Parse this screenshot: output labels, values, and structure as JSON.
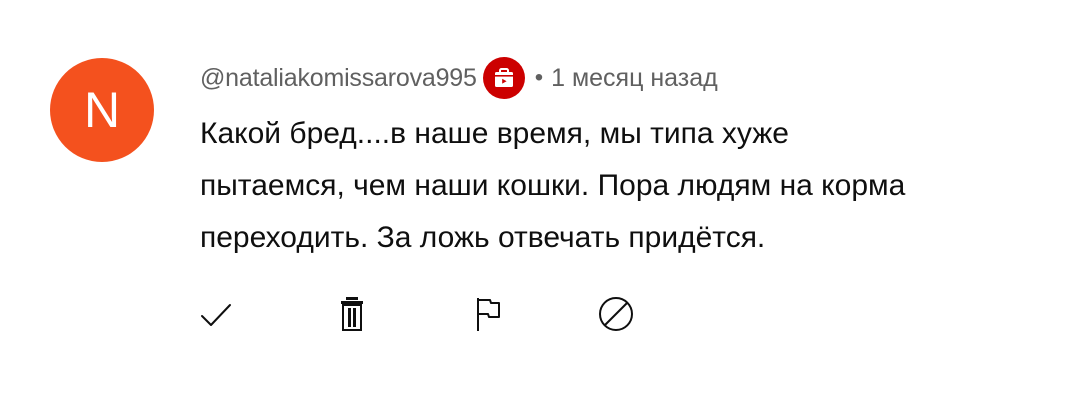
{
  "comment": {
    "avatar_letter": "N",
    "avatar_color": "#f4511e",
    "author": "@nataliakomissarova995",
    "badge_icon": "shopping-bag-icon",
    "separator": "•",
    "time": "1 месяц назад",
    "text_lines": [
      "Какой бред....в наше время, мы типа хуже",
      "пытаемся, чем наши кошки. Пора людям на корма",
      "переходить. За ложь отвечать придётся."
    ]
  },
  "actions": [
    {
      "icon": "checkmark-icon"
    },
    {
      "icon": "trash-icon"
    },
    {
      "icon": "flag-icon"
    },
    {
      "icon": "block-icon"
    }
  ]
}
